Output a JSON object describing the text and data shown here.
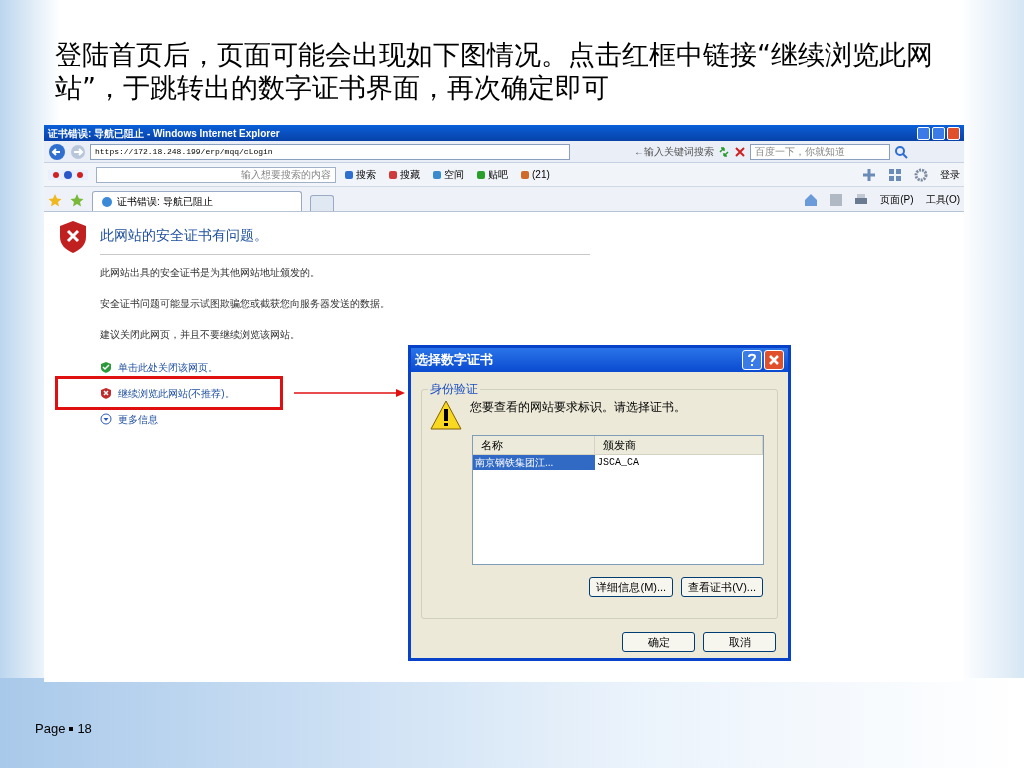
{
  "slide": {
    "title": "登陆首页后，页面可能会出现如下图情况。点击红框中链接“继续浏览此网站”，于跳转出的数字证书界面，再次确定即可",
    "page_label": "Page",
    "page_number": "18"
  },
  "browser": {
    "title": "证书错误: 导航已阻止 - Windows Internet Explorer",
    "address": "https://172.18.248.199/erp/mqq/cLogin",
    "search_hint": "←输入关键词搜索",
    "search_placeholder": "百度一下，你就知道",
    "baidu_placeholder": "输入想要搜索的内容",
    "toolbar_items": [
      {
        "label": "搜索"
      },
      {
        "label": "搜藏"
      },
      {
        "label": "空间"
      },
      {
        "label": "贴吧"
      },
      {
        "label": "(21)"
      }
    ],
    "login": "登录",
    "tab": {
      "label": "证书错误: 导航已阻止",
      "selected": true
    },
    "command_items": [
      {
        "label": "页面(P)"
      },
      {
        "label": "工具(O)"
      }
    ]
  },
  "error_page": {
    "heading": "此网站的安全证书有问题。",
    "paragraphs": [
      "此网站出具的安全证书是为其他网站地址颁发的。",
      "安全证书问题可能显示试图欺骗您或截获您向服务器发送的数据。",
      "建议关闭此网页，并且不要继续浏览该网站。"
    ],
    "links": [
      {
        "kind": "safe",
        "label": "单击此处关闭该网页。",
        "highlighted": false
      },
      {
        "kind": "danger",
        "label": "继续浏览此网站(不推荐)。",
        "highlighted": true
      },
      {
        "kind": "more",
        "label": "更多信息",
        "highlighted": false
      }
    ]
  },
  "dialog": {
    "title": "选择数字证书",
    "group_label": "身份验证",
    "message": "您要查看的网站要求标识。请选择证书。",
    "columns": [
      "名称",
      "颁发商"
    ],
    "rows": [
      {
        "cells": [
          "南京钢铁集团江...",
          "JSCA_CA"
        ],
        "selected": true
      }
    ],
    "buttons": [
      "详细信息(M)...",
      "查看证书(V)..."
    ],
    "footer_buttons": [
      "确定",
      "取消"
    ]
  }
}
